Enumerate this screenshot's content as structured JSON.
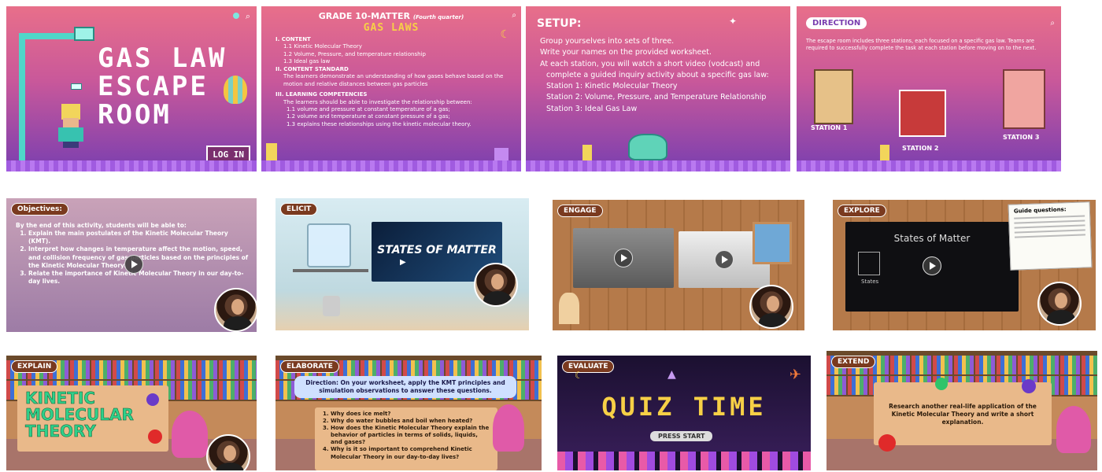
{
  "slide1": {
    "title_line1": "GAS LAW",
    "title_line2": "ESCAPE",
    "title_line3": "ROOM",
    "login_label": "LOG IN",
    "search_icon": "search-icon",
    "toggle_icon": "toggle-icon"
  },
  "slide2": {
    "heading": "GRADE 10-MATTER",
    "heading_sub": "(Fourth quarter)",
    "subtitle": "GAS LAWS",
    "content_title": "I. CONTENT",
    "content_items": [
      "1.1 Kinetic Molecular Theory",
      "1.2 Volume, Pressure, and temperature relationship",
      "1.3 Ideal gas law"
    ],
    "standard_title": "II. CONTENT STANDARD",
    "standard_text": "The learners demonstrate an understanding of how gases behave based on the motion and relative distances between gas particles",
    "competency_title": "III. LEARNING COMPETENCIES",
    "competency_intro": "The learners should be able to investigate the relationship between:",
    "competency_items": [
      "1.1 volume and pressure at constant temperature of a gas;",
      "1.2 volume and temperature at constant pressure of a gas;",
      "1.3 explains these relationships using the kinetic molecular theory."
    ]
  },
  "slide3": {
    "title": "SETUP:",
    "bullets": [
      "Group yourselves into sets of three.",
      "Write your names on the provided worksheet.",
      "At each station, you will watch a short video (vodcast) and complete a guided inquiry activity about a specific gas law:"
    ],
    "stations": [
      "Station 1: Kinetic Molecular Theory",
      "Station 2: Volume, Pressure, and Temperature Relationship",
      "Station 3: Ideal Gas Law"
    ]
  },
  "slide4": {
    "tag": "DIRECTION",
    "text": "The escape room includes three stations, each focused on a specific gas law. Teams are required to successfully complete the task at each station before moving on to the next.",
    "station1": "STATION 1",
    "station2": "STATION 2",
    "station3": "STATION 3"
  },
  "slide5": {
    "tag": "Objectives:",
    "intro": "By the end of this activity, students will be able to:",
    "items": [
      "Explain the main postulates of the Kinetic Molecular Theory (KMT).",
      "Interpret how changes in temperature affect the motion, speed, and collision frequency of gas particles based on the principles of the Kinetic Molecular Theory.",
      "Relate the importance of Kinetic Molecular Theory in our day-to-day lives."
    ]
  },
  "slide6": {
    "tag": "ELICIT",
    "video_title": "STATES OF MATTER"
  },
  "slide7": {
    "tag": "ENGAGE"
  },
  "slide8": {
    "tag": "EXPLORE",
    "video_title": "States of Matter",
    "video_caption": "States",
    "note_title": "Guide questions:"
  },
  "slide9": {
    "tag": "EXPLAIN",
    "title_line1": "KINETIC",
    "title_line2": "MOLECULAR",
    "title_line3": "THEORY"
  },
  "slide10": {
    "tag": "ELABORATE",
    "direction": "Direction: On your worksheet, apply the KMT principles and simulation observations to answer these questions.",
    "questions": [
      "Why does ice melt?",
      "Why do water bubbles and boil when heated?",
      "How does the Kinetic Molecular Theory explain the behavior of particles in terms of solids, liquids, and gases?",
      "Why is it so important to comprehend Kinetic Molecular Theory in our day-to-day lives?"
    ]
  },
  "slide11": {
    "tag": "EVALUATE",
    "title": "QUIZ TIME",
    "button": "PRESS START"
  },
  "slide12": {
    "tag": "EXTEND",
    "text": "Research another real-life application of the Kinetic Molecular Theory and write a short explanation."
  }
}
